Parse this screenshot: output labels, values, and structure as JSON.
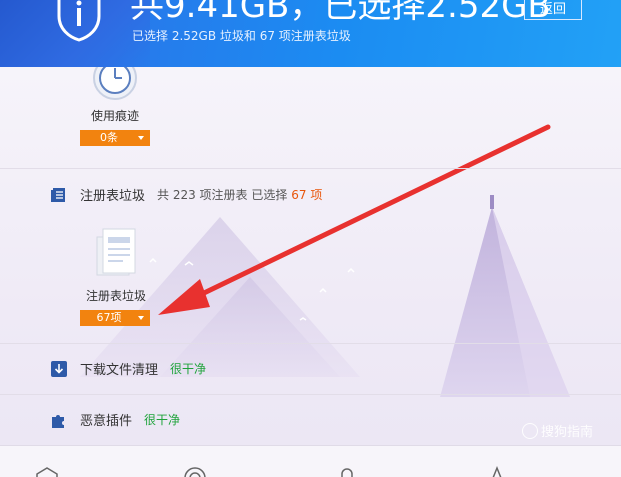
{
  "header": {
    "title": "共9.41GB，已选择2.52GB",
    "subtitle": "已选择 2.52GB 垃圾和 67 项注册表垃圾",
    "back_label": "返回"
  },
  "items": {
    "usage_traces": {
      "label": "使用痕迹",
      "count": "0条"
    },
    "registry": {
      "label": "注册表垃圾",
      "count": "67项"
    }
  },
  "sections": {
    "registry": {
      "title": "注册表垃圾",
      "desc_prefix": "共 223 项注册表 已选择",
      "desc_count": "67",
      "desc_suffix": "项"
    },
    "downloads": {
      "title": "下载文件清理",
      "status": "很干净"
    },
    "plugins": {
      "title": "恶意插件",
      "status": "很干净"
    }
  },
  "watermark": "搜狗指南",
  "colors": {
    "accent_orange": "#f2830f",
    "clean_green": "#1ea33a",
    "header_blue": "#1b8cf2",
    "arrow_red": "#e8312f"
  }
}
